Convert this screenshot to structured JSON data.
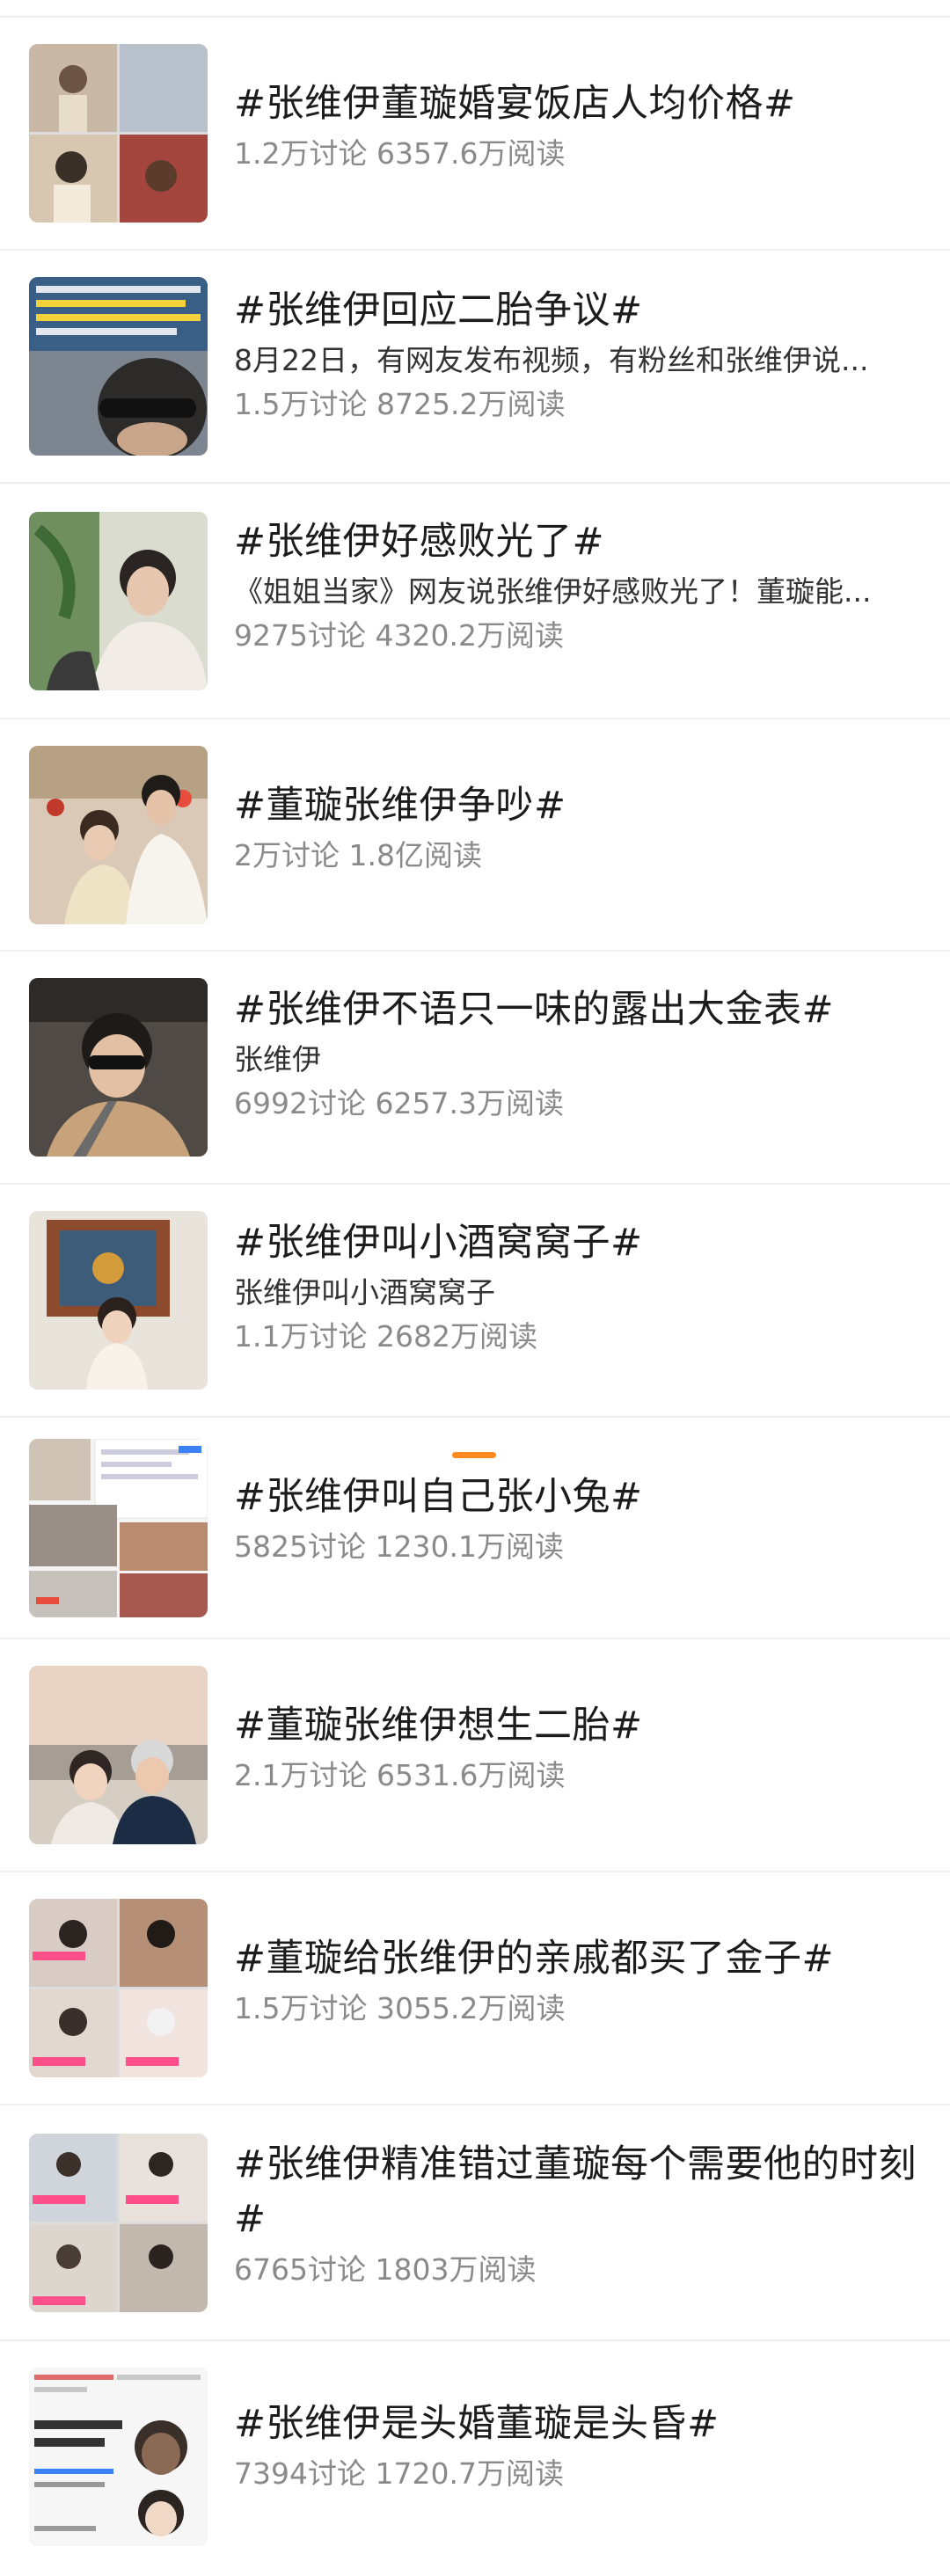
{
  "topics": [
    {
      "title": "#张维伊董璇婚宴饭店人均价格#",
      "summary": "",
      "discussions": "1.2万讨论",
      "reads": "6357.6万阅读",
      "thumb_icon": "collage-thumbnail-icon"
    },
    {
      "title": "#张维伊回应二胎争议#",
      "summary": "8月22日，有网友发布视频，有粉丝和张维伊说...",
      "discussions": "1.5万讨论",
      "reads": "8725.2万阅读",
      "thumb_icon": "video-thumbnail-icon"
    },
    {
      "title": "#张维伊好感败光了#",
      "summary": "《姐姐当家》网友说张维伊好感败光了！董璇能...",
      "discussions": "9275讨论",
      "reads": "4320.2万阅读",
      "thumb_icon": "portrait-thumbnail-icon"
    },
    {
      "title": "#董璇张维伊争吵#",
      "summary": "",
      "discussions": "2万讨论",
      "reads": "1.8亿阅读",
      "thumb_icon": "wedding-thumbnail-icon"
    },
    {
      "title": "#张维伊不语只一味的露出大金表#",
      "summary": "张维伊",
      "discussions": "6992讨论",
      "reads": "6257.3万阅读",
      "thumb_icon": "car-selfie-thumbnail-icon"
    },
    {
      "title": "#张维伊叫小酒窝窝子#",
      "summary": "张维伊叫小酒窝窝子",
      "discussions": "1.1万讨论",
      "reads": "2682万阅读",
      "thumb_icon": "child-thumbnail-icon"
    },
    {
      "title": "#张维伊叫自己张小兔#",
      "summary": "",
      "discussions": "5825讨论",
      "reads": "1230.1万阅读",
      "thumb_icon": "screenshot-collage-thumbnail-icon"
    },
    {
      "title": "#董璇张维伊想生二胎#",
      "summary": "",
      "discussions": "2.1万讨论",
      "reads": "6531.6万阅读",
      "thumb_icon": "beach-couple-thumbnail-icon"
    },
    {
      "title": "#董璇给张维伊的亲戚都买了金子#",
      "summary": "",
      "discussions": "1.5万讨论",
      "reads": "3055.2万阅读",
      "thumb_icon": "collage-thumbnail-icon"
    },
    {
      "title": "#张维伊精准错过董璇每个需要他的时刻#",
      "summary": "",
      "discussions": "6765讨论",
      "reads": "1803万阅读",
      "thumb_icon": "collage-thumbnail-icon"
    },
    {
      "title": "#张维伊是头婚董璇是头昏#",
      "summary": "",
      "discussions": "7394讨论",
      "reads": "1720.7万阅读",
      "thumb_icon": "screenshot-collage-thumbnail-icon"
    }
  ],
  "colors": {
    "title": "#1c1c1c",
    "summary": "#333333",
    "stats": "#8a8a8a",
    "divider": "#efefef",
    "loading_accent": "#ff8a1f"
  }
}
